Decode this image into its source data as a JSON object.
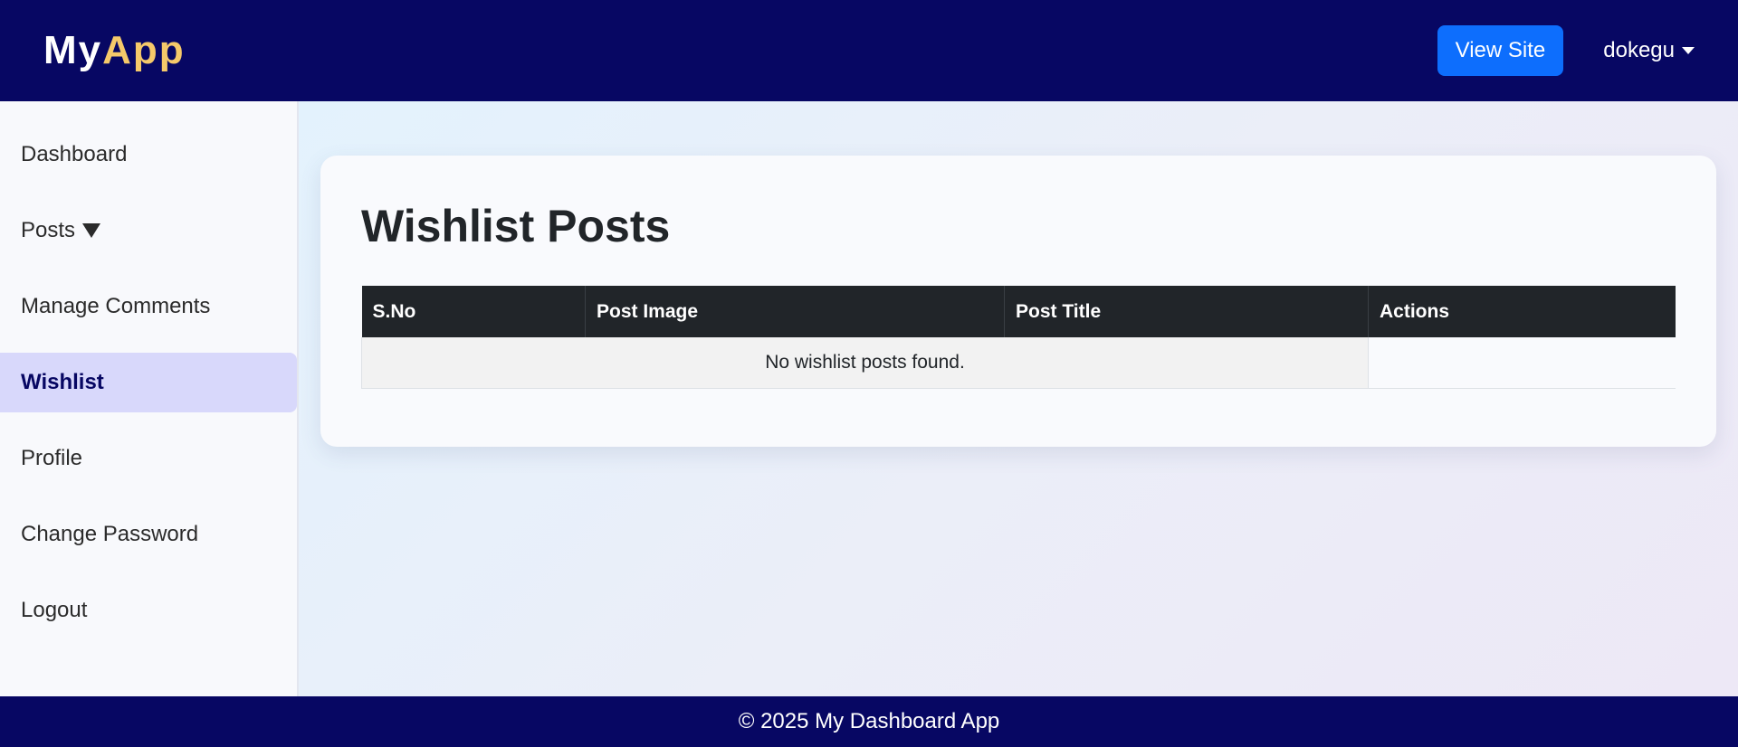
{
  "header": {
    "brand_part1": "My",
    "brand_part2": "App",
    "view_site_label": "View Site",
    "username": "dokegu"
  },
  "sidebar": {
    "items": [
      {
        "label": "Dashboard"
      },
      {
        "label": "Posts"
      },
      {
        "label": "Manage Comments"
      },
      {
        "label": "Wishlist"
      },
      {
        "label": "Profile"
      },
      {
        "label": "Change Password"
      },
      {
        "label": "Logout"
      }
    ],
    "active_item": "Wishlist"
  },
  "main": {
    "title": "Wishlist Posts",
    "table": {
      "columns": [
        "S.No",
        "Post Image",
        "Post Title",
        "Actions"
      ],
      "empty_message": "No wishlist posts found."
    }
  },
  "footer": {
    "text": "© 2025 My Dashboard App"
  },
  "colors": {
    "navbar": "#070763",
    "brand_accent": "#f5c96a",
    "primary_button": "#0d6efd",
    "active_sidebar_bg": "#d8d8fb",
    "table_header": "#212529"
  },
  "icons": {
    "user_menu": "caret-down-icon",
    "posts_toggle": "triangle-down-icon"
  }
}
